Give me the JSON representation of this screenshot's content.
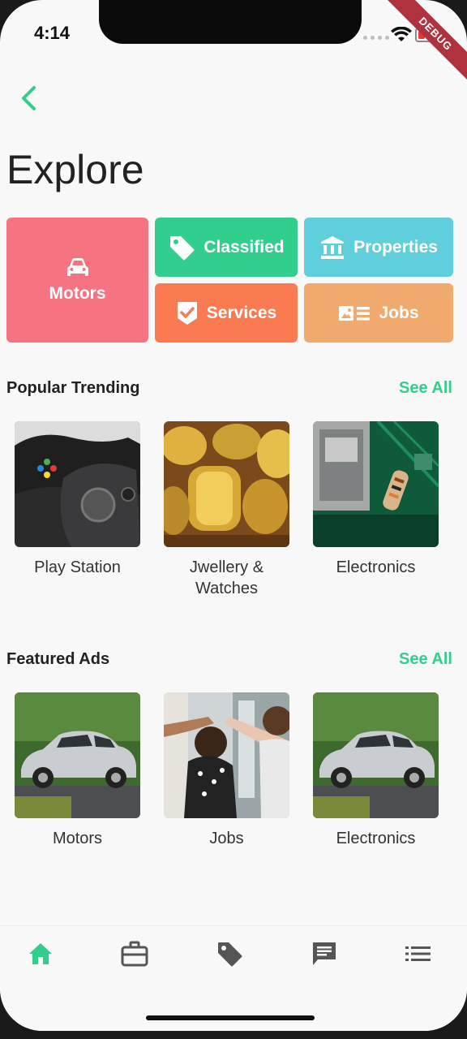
{
  "status_bar": {
    "time": "4:14",
    "debug_label": "DEBUG"
  },
  "header": {
    "title": "Explore"
  },
  "categories": {
    "motors": {
      "label": "Motors",
      "color": "#f67382",
      "icon": "car-icon"
    },
    "classified": {
      "label": "Classified",
      "color": "#32ce8e",
      "icon": "tag-icon"
    },
    "properties": {
      "label": "Properties",
      "color": "#5ecfdb",
      "icon": "bank-icon"
    },
    "services": {
      "label": "Services",
      "color": "#fa7b52",
      "icon": "verified-badge-icon"
    },
    "jobs": {
      "label": "Jobs",
      "color": "#f0aa6e",
      "icon": "id-card-icon"
    }
  },
  "popular": {
    "title": "Popular Trending",
    "see_all": "See All",
    "items": [
      {
        "label": "Play Station"
      },
      {
        "label": "Jwellery & Watches"
      },
      {
        "label": "Electronics"
      }
    ]
  },
  "featured": {
    "title": "Featured Ads",
    "see_all": "See All",
    "items": [
      {
        "label": "Motors"
      },
      {
        "label": "Jobs"
      },
      {
        "label": "Electronics"
      }
    ]
  },
  "bottom_nav": {
    "items": [
      {
        "icon": "home-icon",
        "active": true
      },
      {
        "icon": "briefcase-icon",
        "active": false
      },
      {
        "icon": "tag-icon",
        "active": false
      },
      {
        "icon": "chat-icon",
        "active": false
      },
      {
        "icon": "list-icon",
        "active": false
      }
    ],
    "active_color": "#32ce8e",
    "inactive_color": "#555555"
  }
}
